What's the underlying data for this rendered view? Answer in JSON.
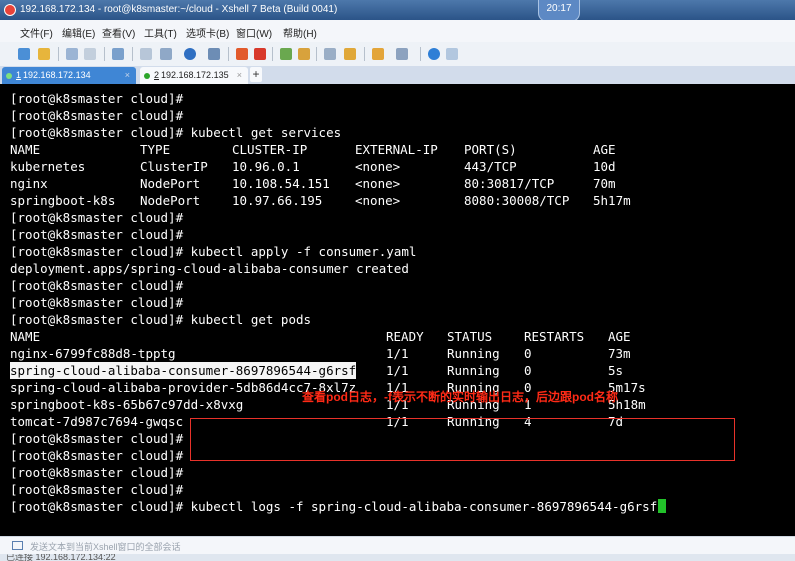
{
  "window": {
    "title": "192.168.172.134 - root@k8smaster:~/cloud - Xshell 7 Beta (Build 0041)"
  },
  "clock": "20:17",
  "menu": [
    "文件(F)",
    "编辑(E)",
    "查看(V)",
    "工具(T)",
    "选项卡(B)",
    "窗口(W)",
    "帮助(H)"
  ],
  "tabs": [
    {
      "number": "1",
      "host": "192.168.172.134"
    },
    {
      "number": "2",
      "host": "192.168.172.135"
    }
  ],
  "tab_add": "+",
  "tab_close": "×",
  "terminal": {
    "prompt": "[root@k8smaster cloud]#",
    "cmd_services": "kubectl get services",
    "services_header": [
      "NAME",
      "TYPE",
      "CLUSTER-IP",
      "EXTERNAL-IP",
      "PORT(S)",
      "AGE"
    ],
    "services": [
      [
        "kubernetes",
        "ClusterIP",
        "10.96.0.1",
        "<none>",
        "443/TCP",
        "10d"
      ],
      [
        "nginx",
        "NodePort",
        "10.108.54.151",
        "<none>",
        "80:30817/TCP",
        "70m"
      ],
      [
        "springboot-k8s",
        "NodePort",
        "10.97.66.195",
        "<none>",
        "8080:30008/TCP",
        "5h17m"
      ]
    ],
    "cmd_apply": "kubectl apply -f consumer.yaml",
    "apply_output": "deployment.apps/spring-cloud-alibaba-consumer created",
    "cmd_pods": "kubectl get pods",
    "pods_header": [
      "NAME",
      "READY",
      "STATUS",
      "RESTARTS",
      "AGE"
    ],
    "pods": [
      [
        "nginx-6799fc88d8-tpptg",
        "1/1",
        "Running",
        "0",
        "73m"
      ],
      [
        "spring-cloud-alibaba-consumer-8697896544-g6rsf",
        "1/1",
        "Running",
        "0",
        "5s"
      ],
      [
        "spring-cloud-alibaba-provider-5db86d4cc7-8xl7z",
        "1/1",
        "Running",
        "0",
        "5m17s"
      ],
      [
        "springboot-k8s-65b67c97dd-x8vxg",
        "1/1",
        "Running",
        "1",
        "5h18m"
      ],
      [
        "tomcat-7d987c7694-gwqsc",
        "1/1",
        "Running",
        "4",
        "7d"
      ]
    ],
    "cmd_logs": "kubectl logs -f spring-cloud-alibaba-consumer-8697896544-g6rsf"
  },
  "annotation": "查看pod日志，-f表示不断的实时输出日志，后边跟pod名称",
  "send_bar_placeholder": "发送文本到当前Xshell窗口的全部会话",
  "status_text": "已连接 192.168.172.134:22",
  "colors": {
    "cursor": "#22c22a",
    "annotation": "#ff2a16",
    "highlight_bg": "#f5f5f5",
    "terminal_bg": "#000000"
  }
}
